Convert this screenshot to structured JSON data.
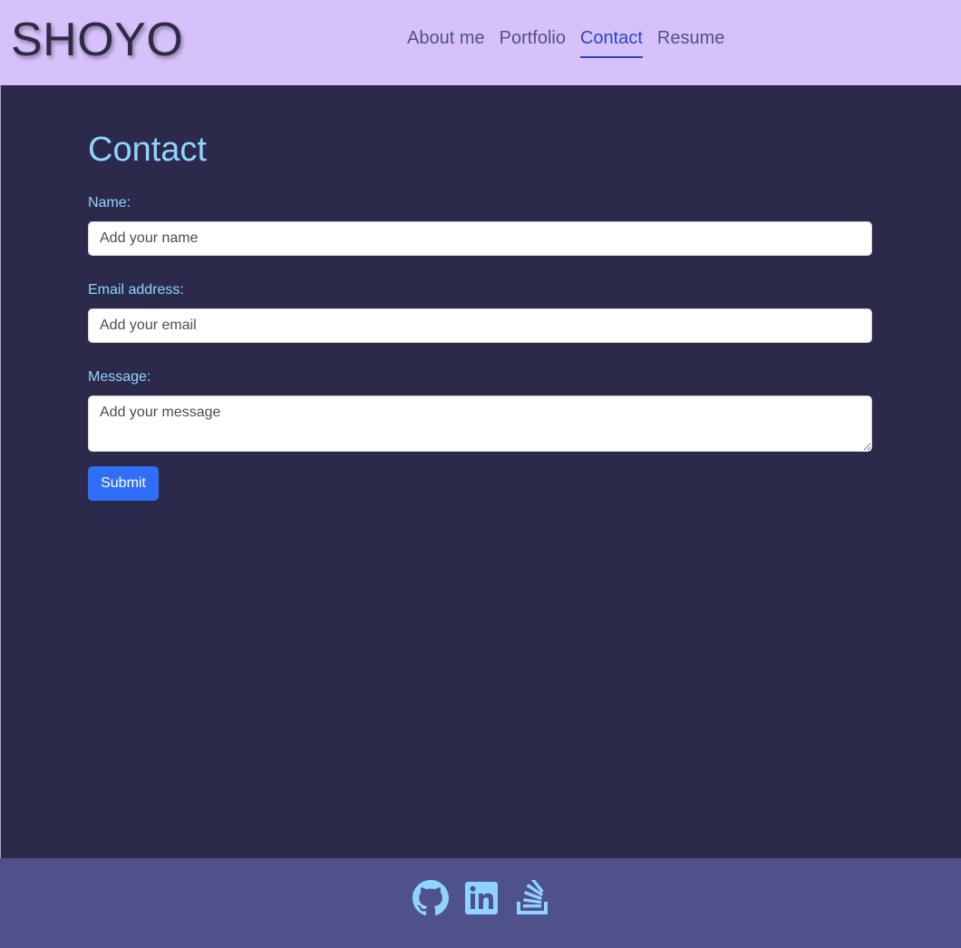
{
  "header": {
    "brand": "SHOYO",
    "nav": [
      {
        "label": "About me",
        "active": false
      },
      {
        "label": "Portfolio",
        "active": false
      },
      {
        "label": "Contact",
        "active": true
      },
      {
        "label": "Resume",
        "active": false
      }
    ]
  },
  "main": {
    "title": "Contact",
    "form": {
      "name": {
        "label": "Name:",
        "placeholder": "Add your name",
        "value": ""
      },
      "email": {
        "label": "Email address:",
        "placeholder": "Add your email",
        "value": ""
      },
      "message": {
        "label": "Message:",
        "placeholder": "Add your message",
        "value": ""
      },
      "submit_label": "Submit"
    }
  },
  "footer": {
    "social_icons": [
      "github-icon",
      "linkedin-icon",
      "stack-overflow-icon"
    ]
  },
  "colors": {
    "header_bg": "#d7c1fb",
    "body_bg": "#2c2a4a",
    "footer_bg": "#4f518b",
    "accent_text": "#8ed4ff",
    "nav_text": "#4f518c",
    "nav_active": "#2448c4",
    "button": "#2f6ef7"
  }
}
